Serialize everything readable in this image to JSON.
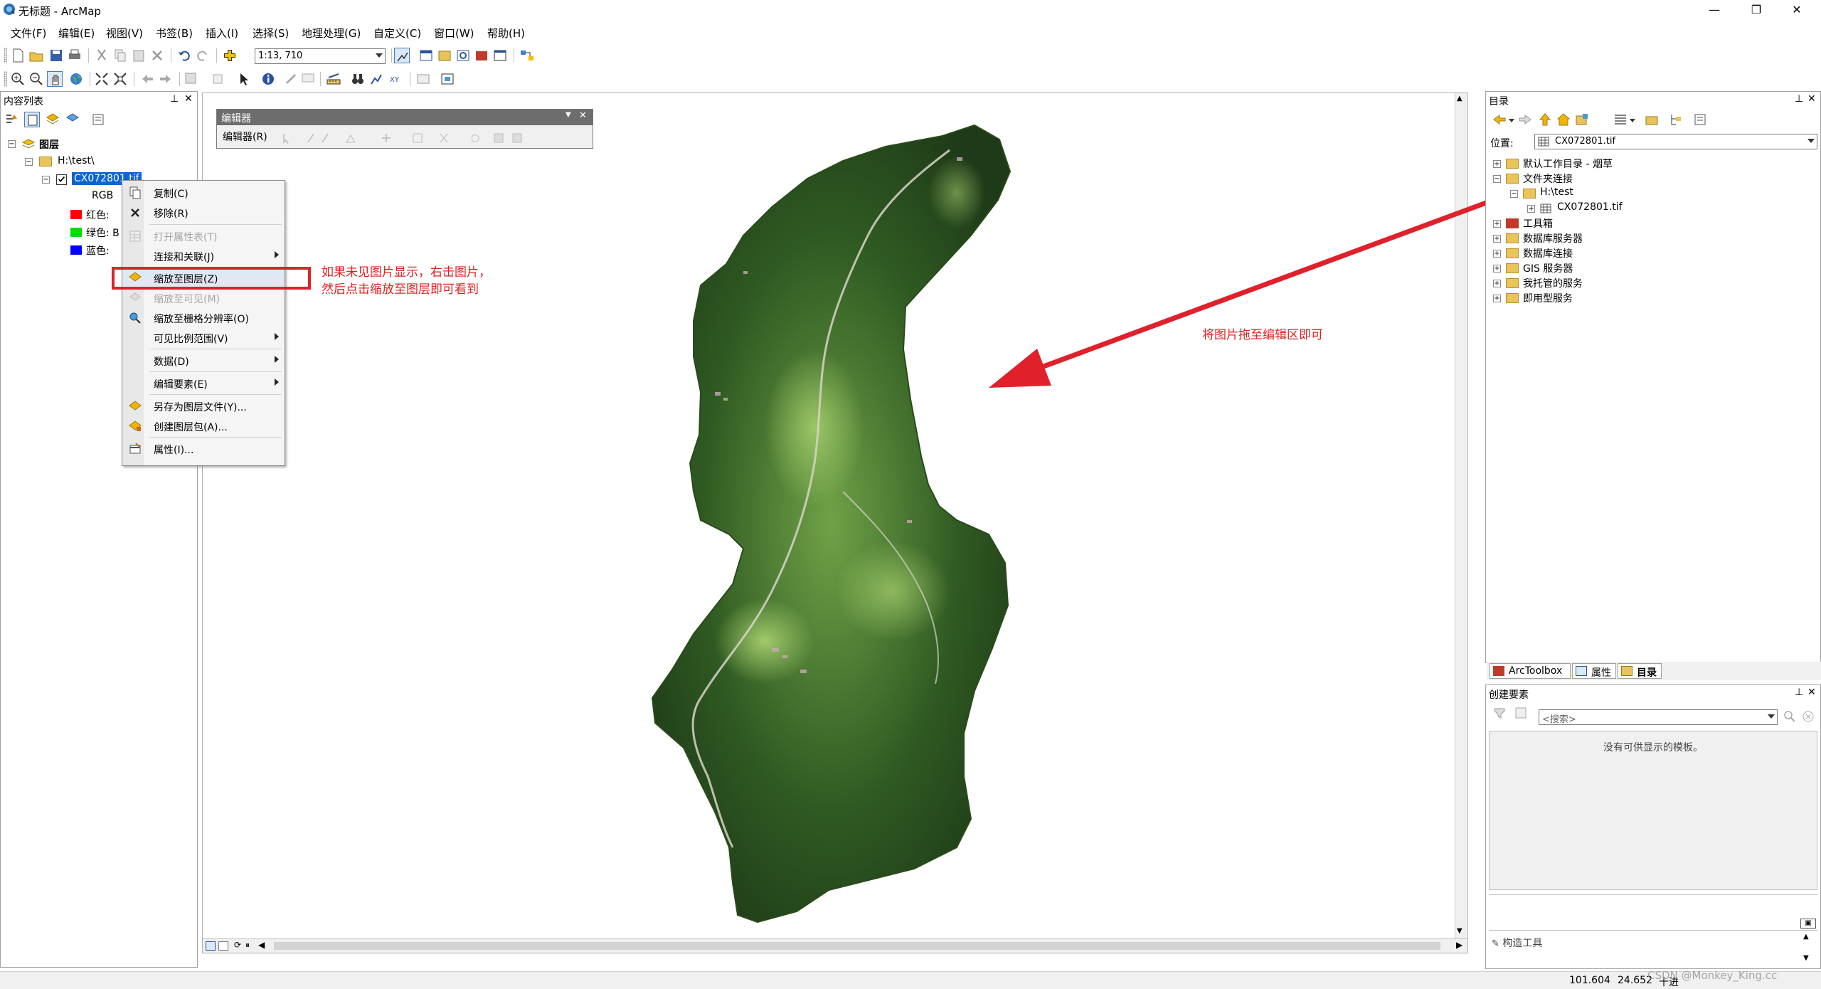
{
  "window": {
    "title": "无标题 - ArcMap",
    "controls": {
      "minimize": "—",
      "restore": "❐",
      "close": "✕"
    }
  },
  "menubar": {
    "items": [
      "文件(F)",
      "编辑(E)",
      "视图(V)",
      "书签(B)",
      "插入(I)",
      "选择(S)",
      "地理处理(G)",
      "自定义(C)",
      "窗口(W)",
      "帮助(H)"
    ]
  },
  "toolbar": {
    "scale_value": "1:13, 710"
  },
  "toc": {
    "title": "内容列表",
    "root_label": "图层",
    "folder_label": "H:\\test\\",
    "layer_label": "CX072801.tif",
    "rgb_label": "RGB",
    "bands": [
      {
        "label": "红色:",
        "color": "#ff0000"
      },
      {
        "label": "绿色: B",
        "color": "#00dd00"
      },
      {
        "label": "蓝色:",
        "color": "#0000ff"
      }
    ]
  },
  "context_menu": {
    "items": [
      {
        "label": "复制(C)",
        "icon": "copy-icon",
        "disabled": false,
        "submenu": false
      },
      {
        "label": "移除(R)",
        "icon": "remove-icon",
        "disabled": false,
        "submenu": false
      },
      {
        "label": "打开属性表(T)",
        "icon": "table-icon",
        "disabled": true,
        "submenu": false
      },
      {
        "label": "连接和关联(J)",
        "icon": "",
        "disabled": false,
        "submenu": true
      },
      {
        "label": "缩放至图层(Z)",
        "icon": "zoom-to-layer-icon",
        "disabled": false,
        "submenu": false,
        "highlighted": true
      },
      {
        "label": "缩放至可见(M)",
        "icon": "zoom-visible-icon",
        "disabled": true,
        "submenu": false
      },
      {
        "label": "缩放至栅格分辨率(O)",
        "icon": "zoom-raster-icon",
        "disabled": false,
        "submenu": false
      },
      {
        "label": "可见比例范围(V)",
        "icon": "",
        "disabled": false,
        "submenu": true
      },
      {
        "label": "数据(D)",
        "icon": "",
        "disabled": false,
        "submenu": true
      },
      {
        "label": "编辑要素(E)",
        "icon": "",
        "disabled": false,
        "submenu": true
      },
      {
        "label": "另存为图层文件(Y)...",
        "icon": "layer-file-icon",
        "disabled": false,
        "submenu": false
      },
      {
        "label": "创建图层包(A)...",
        "icon": "layer-package-icon",
        "disabled": false,
        "submenu": false
      },
      {
        "label": "属性(I)...",
        "icon": "properties-icon",
        "disabled": false,
        "submenu": false
      }
    ]
  },
  "annotations": {
    "left_line1": "如果未见图片显示，右击图片，",
    "left_line2": "然后点击缩放至图层即可看到",
    "right": "将图片拖至编辑区即可"
  },
  "editor_toolbar": {
    "title": "编辑器",
    "menu_label": "编辑器(R)"
  },
  "catalog": {
    "title": "目录",
    "location_label": "位置:",
    "location_value": "CX072801.tif",
    "tree": [
      {
        "label": "默认工作目录 - 烟草",
        "expander": "+"
      },
      {
        "label": "文件夹连接",
        "expander": "-"
      },
      {
        "label": "H:\\test",
        "expander": "-"
      },
      {
        "label": "CX072801.tif",
        "expander": "+"
      },
      {
        "label": "工具箱",
        "expander": "+"
      },
      {
        "label": "数据库服务器",
        "expander": "+"
      },
      {
        "label": "数据库连接",
        "expander": "+"
      },
      {
        "label": "GIS 服务器",
        "expander": "+"
      },
      {
        "label": "我托管的服务",
        "expander": "+"
      },
      {
        "label": "即用型服务",
        "expander": "+"
      }
    ],
    "tabs": [
      "ArcToolbox",
      "属性",
      "目录"
    ]
  },
  "create_features": {
    "title": "创建要素",
    "search_placeholder": "<搜索>",
    "empty_message": "没有可供显示的模板。",
    "construct_tools": "构造工具"
  },
  "statusbar": {
    "x": "101.604",
    "y": "24.652",
    "unit": "十进",
    "watermark": "CSDN @Monkey_King.cc"
  }
}
